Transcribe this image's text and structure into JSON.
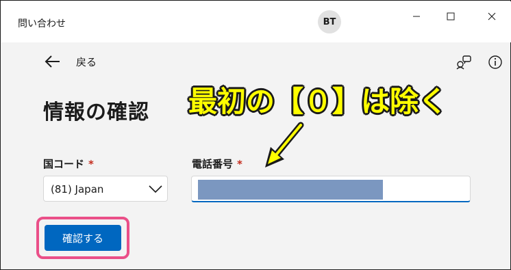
{
  "window": {
    "title": "問い合わせ",
    "avatar_initials": "BT",
    "controls": [
      "minimize-icon",
      "maximize-icon",
      "close-icon"
    ]
  },
  "nav": {
    "back_label": "戻る",
    "icons": [
      "back-arrow-icon",
      "feedback-icon",
      "info-icon"
    ]
  },
  "page": {
    "title": "情報の確認"
  },
  "annotation": {
    "text": "最初の【０】は除く",
    "color": "#ffff00"
  },
  "form": {
    "country_label": "国コード",
    "country_required": "*",
    "country_value": "(81) Japan",
    "phone_label": "電話番号",
    "phone_required": "*",
    "phone_value_redacted": true
  },
  "actions": {
    "confirm_label": "確認する"
  },
  "colors": {
    "accent": "#0067c0",
    "highlight_border": "#ea4f88",
    "required": "#c42b1c",
    "redaction": "#7b97c0"
  }
}
